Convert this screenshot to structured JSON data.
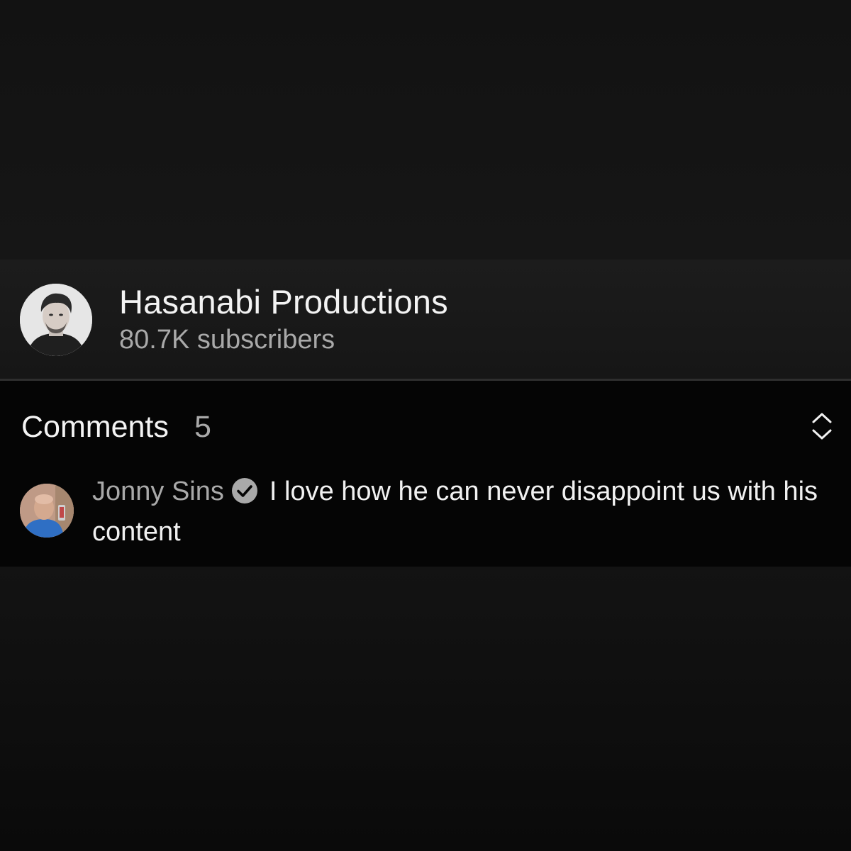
{
  "channel": {
    "name": "Hasanabi Productions",
    "subscribers": "80.7K subscribers"
  },
  "comments": {
    "title": "Comments",
    "count": "5",
    "expand_icon": "expand-collapse-chevrons-icon",
    "top_comment": {
      "author": "Jonny Sins",
      "verified_icon": "verified-check-icon",
      "text": "I love how he can never disappoint us with his content"
    }
  },
  "colors": {
    "background": "#0d0d0d",
    "primary_text": "#f1f1f1",
    "secondary_text": "#a9a9a9",
    "panel": "#050505"
  }
}
